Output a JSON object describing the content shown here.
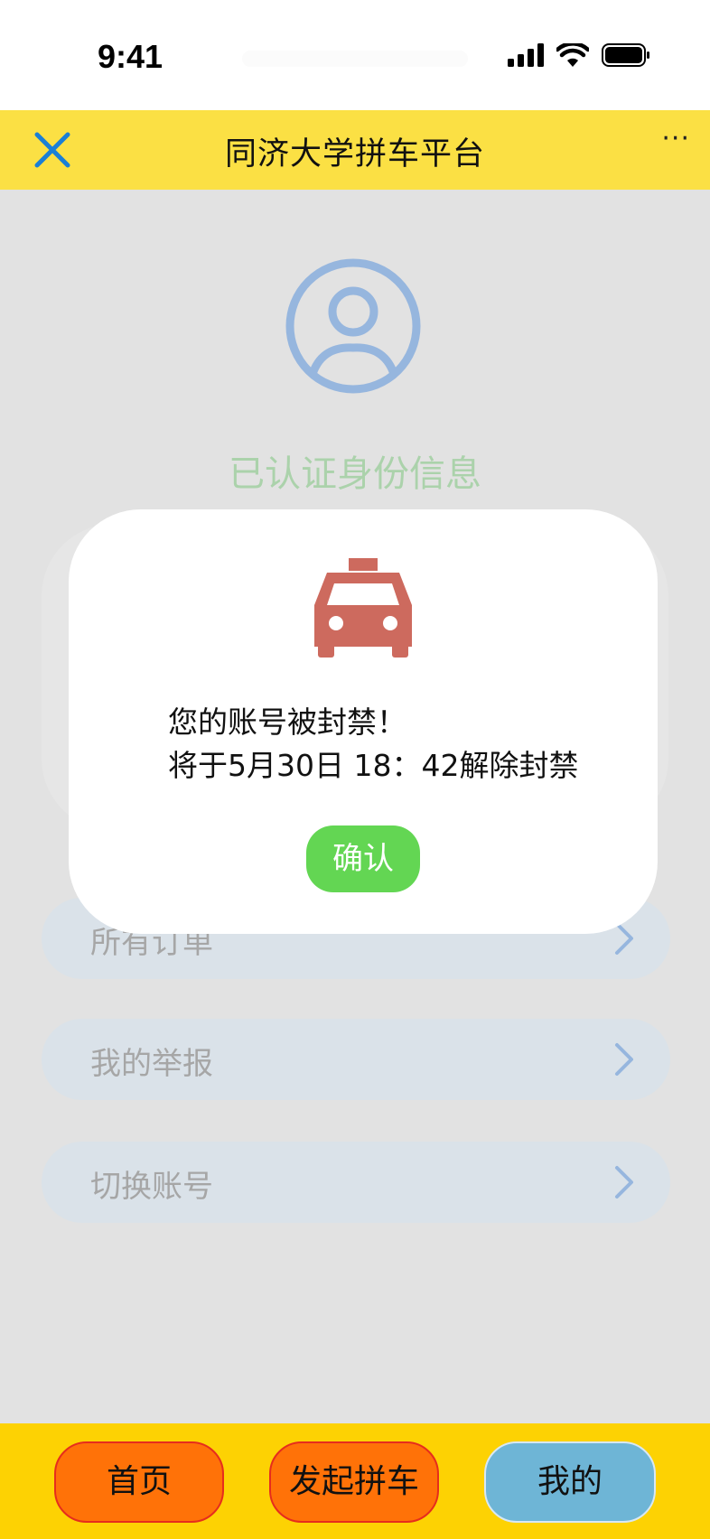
{
  "status_bar": {
    "time": "9:41"
  },
  "header": {
    "title": "同济大学拼车平台",
    "more_label": "···"
  },
  "profile": {
    "verified_label": "已认证身份信息"
  },
  "menu": {
    "items": [
      {
        "label": "所有订单"
      },
      {
        "label": "我的举报"
      },
      {
        "label": "切换账号"
      }
    ]
  },
  "modal": {
    "message_line1": "您的账号被封禁！",
    "message_line2": "将于5月30日 18：42解除封禁",
    "confirm_label": "确认"
  },
  "bottom_nav": {
    "home_label": "首页",
    "start_carpool_label": "发起拼车",
    "mine_label": "我的"
  },
  "colors": {
    "header_bg": "#fbe044",
    "bottom_nav_bg": "#fdd203",
    "nav_orange": "#ff7208",
    "nav_blue": "#6eb5d6",
    "confirm_green": "#63d653",
    "taxi_red": "#cd6a5e",
    "close_blue": "#1a7fd6"
  },
  "icons": {
    "close": "close-icon",
    "avatar": "user-avatar-icon",
    "taxi": "taxi-icon",
    "chevron": "chevron-right-icon"
  }
}
